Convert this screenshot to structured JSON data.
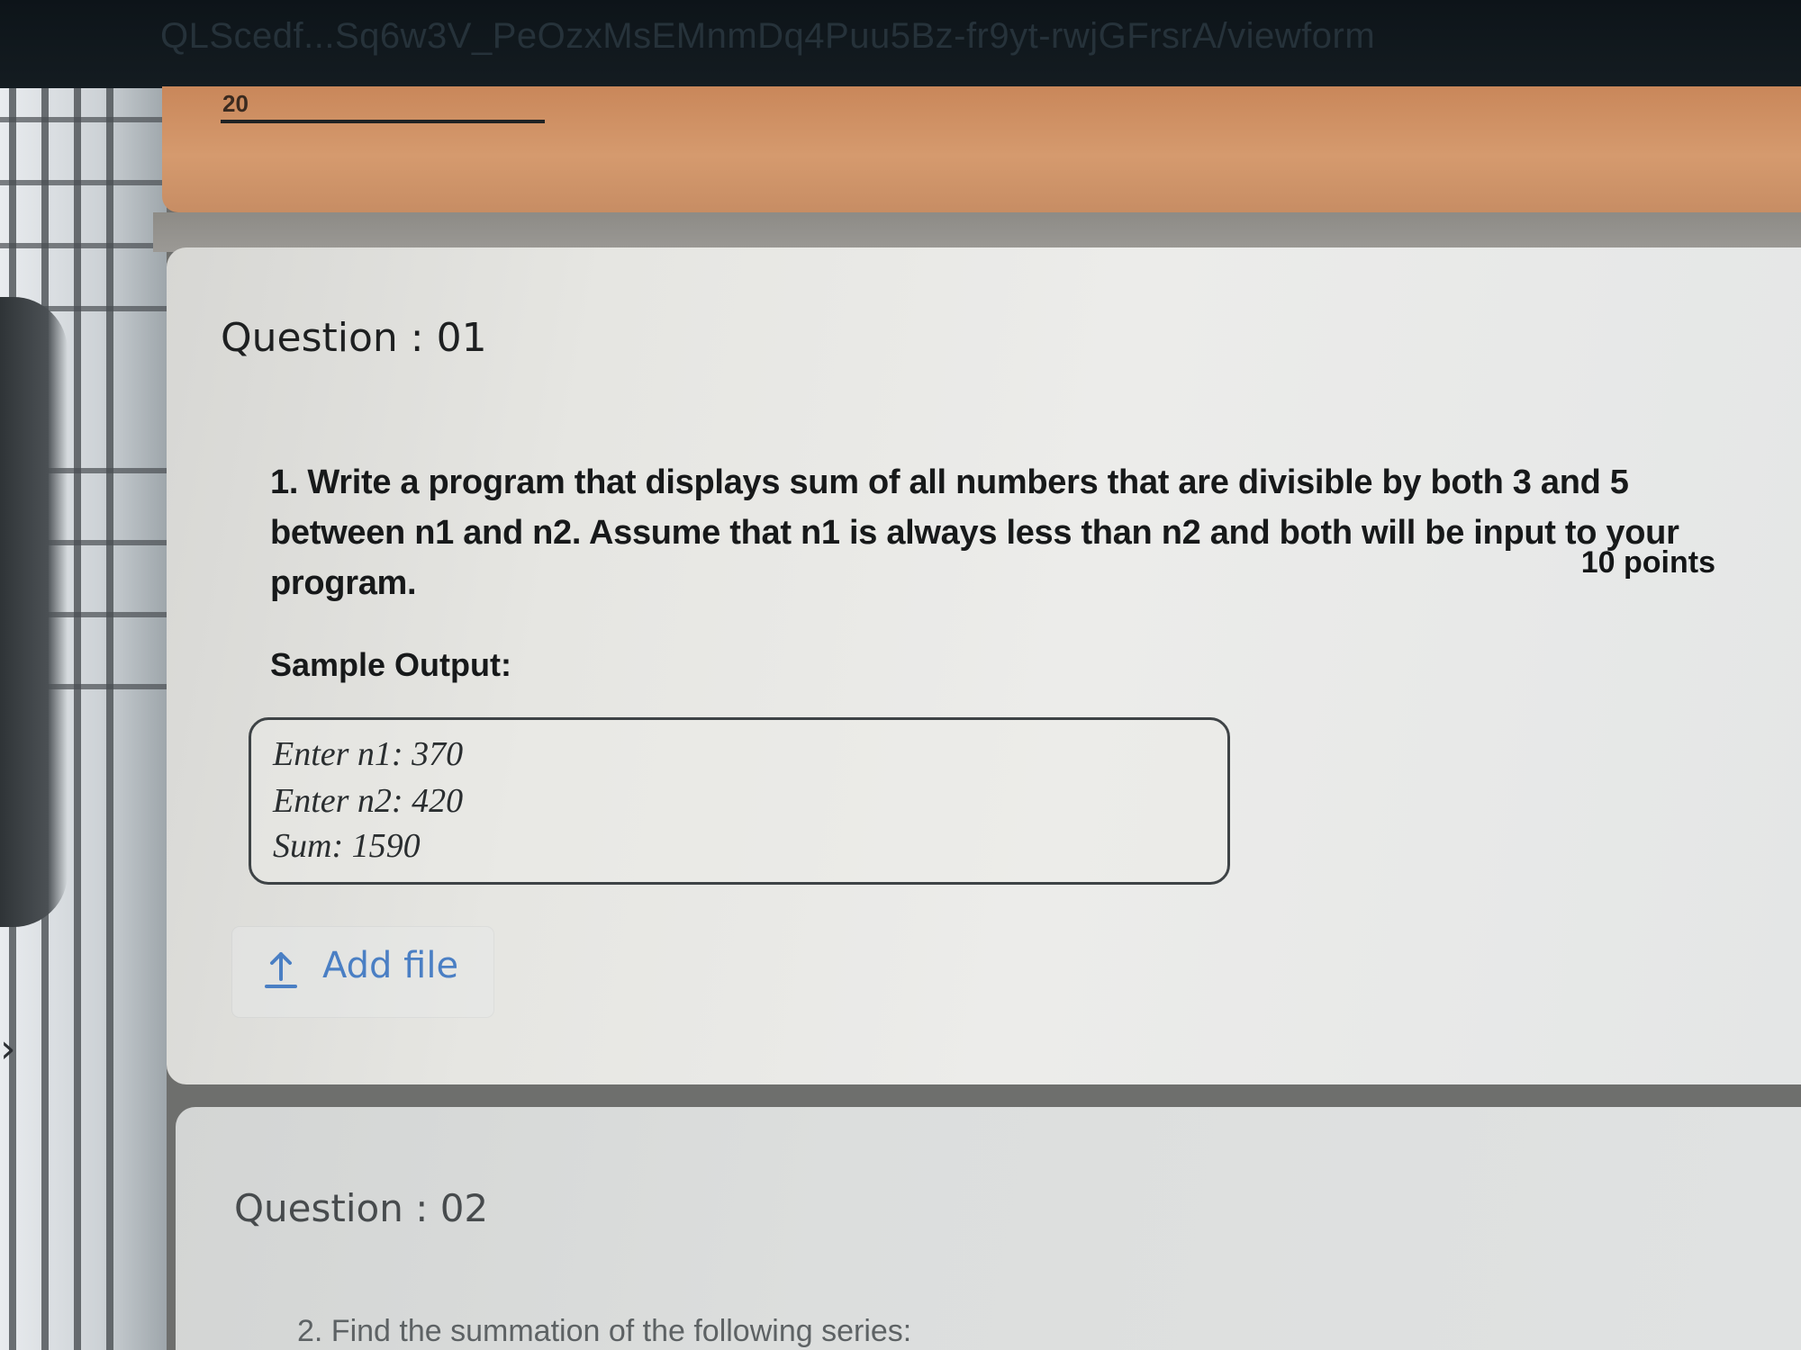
{
  "browser": {
    "url_fragment": "QLScedf...Sq6w3V_PeOzxMsEMnmDq4Puu5Bz-fr9yt-rwjGFrsrA/viewform"
  },
  "colors": {
    "header_accent": "#d59a6e",
    "link_blue": "#4a7fc4"
  },
  "previous_section": {
    "underline_text": "20"
  },
  "question1": {
    "title": "Question : 01",
    "text": "1. Write a program that displays sum of all numbers that are divisible by both 3 and 5 between n1 and n2. Assume that n1 is always less than n2 and both will be input to your program.",
    "points": "10 points",
    "sample_output_label": "Sample Output:",
    "sample_output_lines": [
      "Enter n1: 370",
      "Enter n2: 420",
      "Sum: 1590"
    ],
    "add_file": {
      "icon": "upload-icon",
      "label": "Add file"
    }
  },
  "question2": {
    "title": "Question : 02",
    "text": "2. Find the summation of the following series:"
  }
}
